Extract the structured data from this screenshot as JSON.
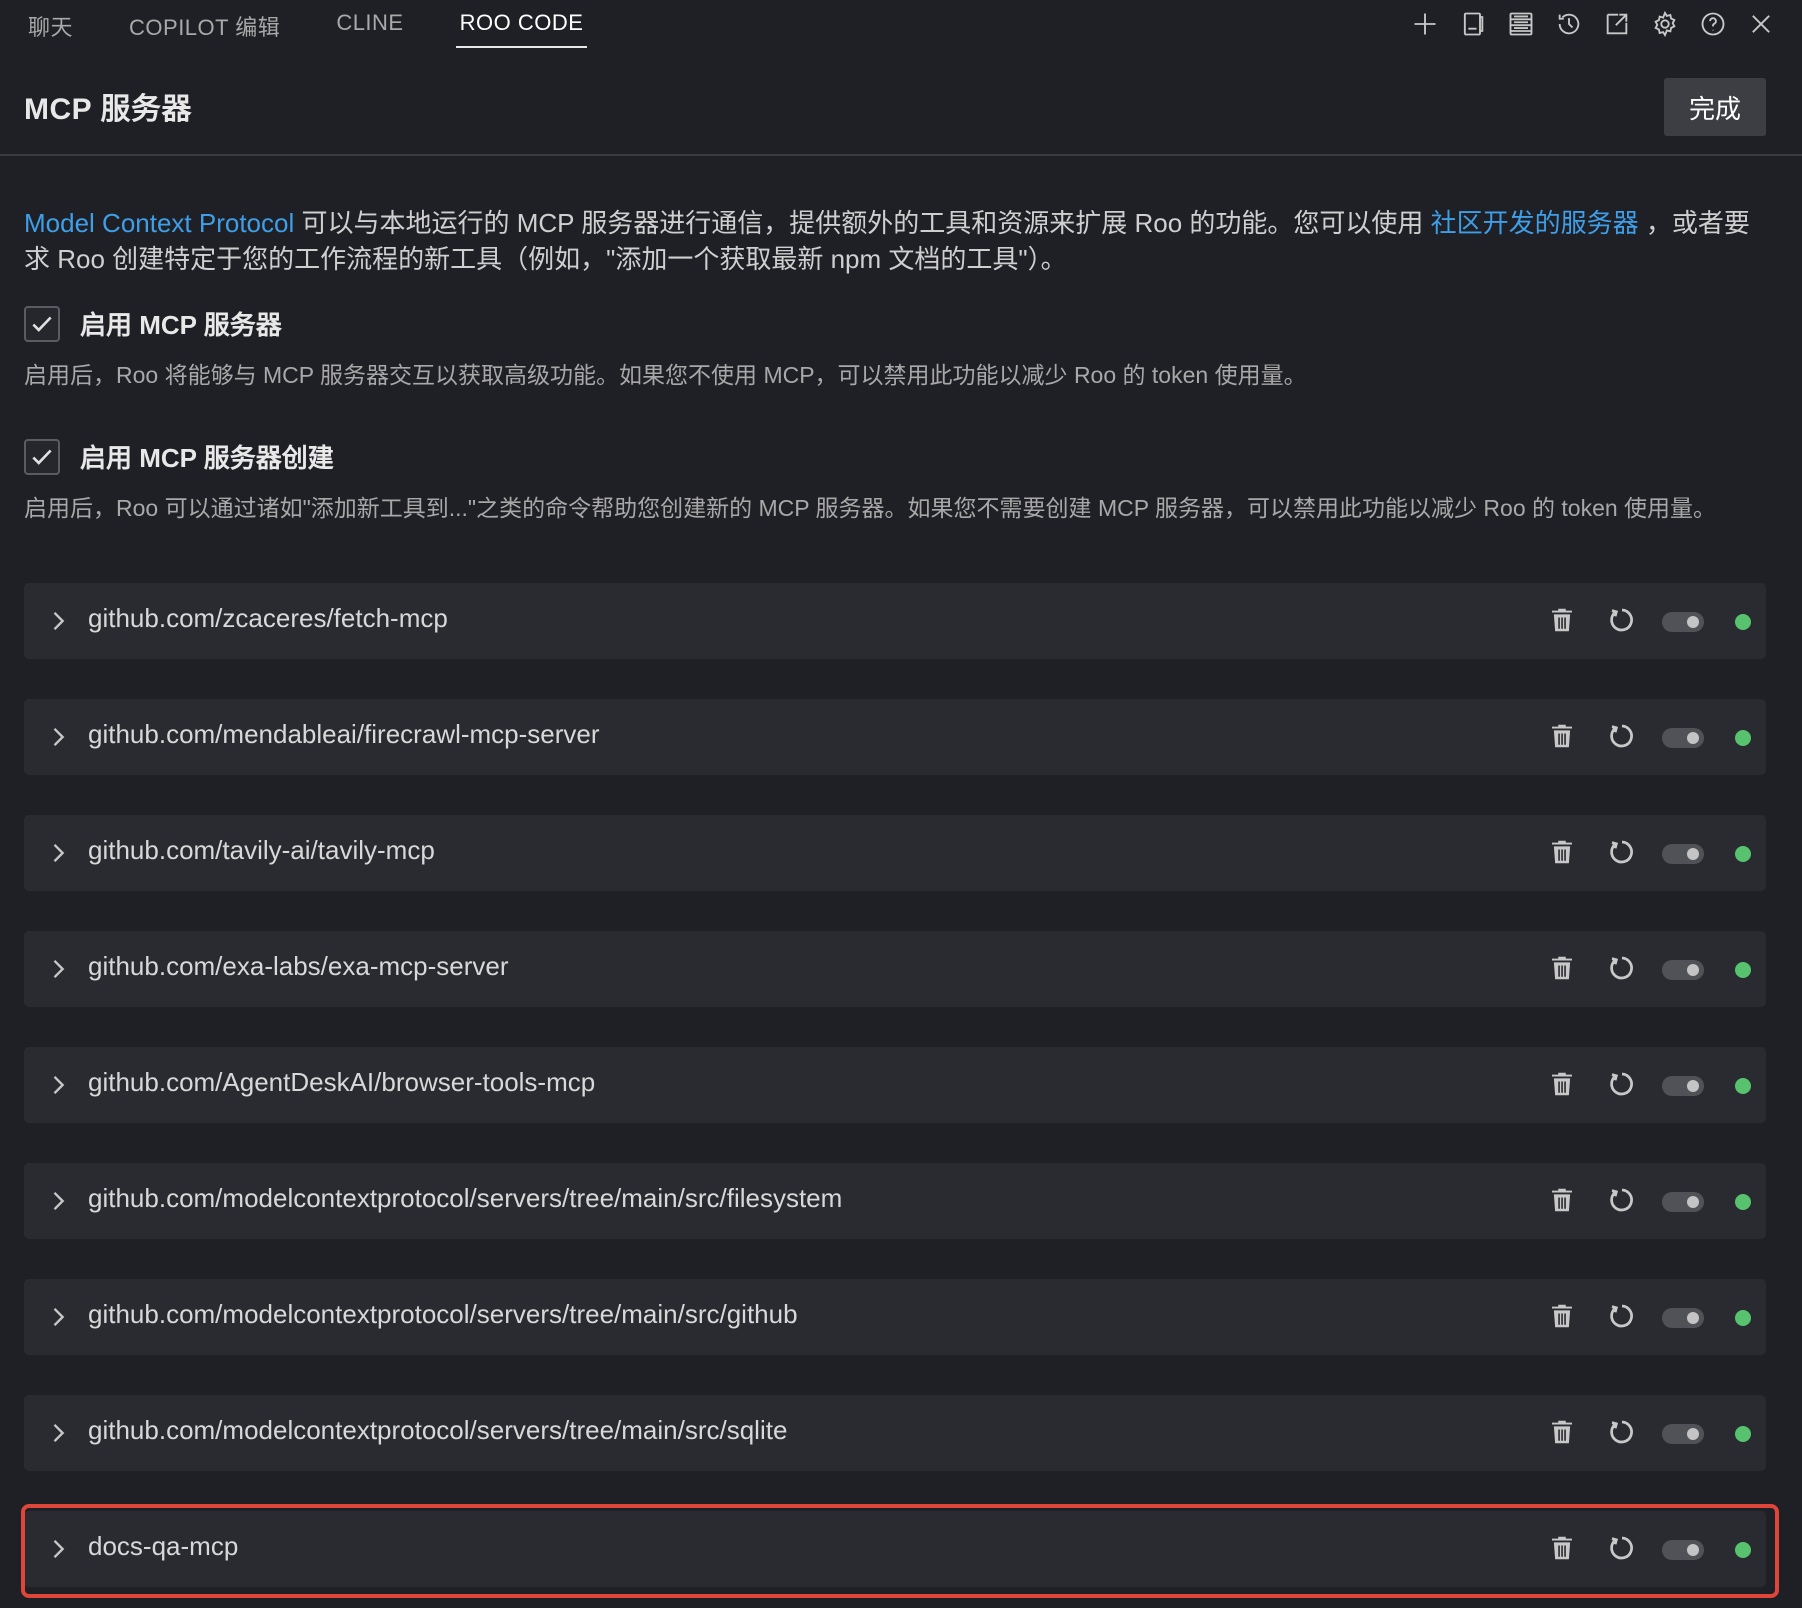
{
  "tabs": [
    {
      "label": "聊天"
    },
    {
      "label": "COPILOT 编辑"
    },
    {
      "label": "CLINE"
    },
    {
      "label": "ROO CODE",
      "active": true
    }
  ],
  "toolbar_icons": [
    "plus-icon",
    "panel-icon",
    "server-stack-icon",
    "history-icon",
    "popout-icon",
    "gear-icon",
    "help-icon",
    "close-icon"
  ],
  "header": {
    "title": "MCP 服务器",
    "done_label": "完成"
  },
  "intro": {
    "link1": "Model Context Protocol",
    "text1": " 可以与本地运行的 MCP 服务器进行通信，提供额外的工具和资源来扩展 Roo 的功能。您可以使用 ",
    "link2": "社区开发的服务器",
    "text2": " ，或者要求 Roo 创建特定于您的工作流程的新工具（例如，\"添加一个获取最新 npm 文档的工具\"）。"
  },
  "options": [
    {
      "label": "启用 MCP 服务器",
      "checked": true,
      "description": "启用后，Roo 将能够与 MCP 服务器交互以获取高级功能。如果您不使用 MCP，可以禁用此功能以减少 Roo 的 token 使用量。"
    },
    {
      "label": "启用 MCP 服务器创建",
      "checked": true,
      "description": "启用后，Roo 可以通过诸如\"添加新工具到...\"之类的命令帮助您创建新的 MCP 服务器。如果您不需要创建 MCP 服务器，可以禁用此功能以减少 Roo 的 token 使用量。"
    }
  ],
  "servers": [
    {
      "name": "github.com/zcaceres/fetch-mcp",
      "enabled": true,
      "status": "connected"
    },
    {
      "name": "github.com/mendableai/firecrawl-mcp-server",
      "enabled": true,
      "status": "connected"
    },
    {
      "name": "github.com/tavily-ai/tavily-mcp",
      "enabled": true,
      "status": "connected"
    },
    {
      "name": "github.com/exa-labs/exa-mcp-server",
      "enabled": true,
      "status": "connected"
    },
    {
      "name": "github.com/AgentDeskAI/browser-tools-mcp",
      "enabled": true,
      "status": "connected"
    },
    {
      "name": "github.com/modelcontextprotocol/servers/tree/main/src/filesystem",
      "enabled": true,
      "status": "connected"
    },
    {
      "name": "github.com/modelcontextprotocol/servers/tree/main/src/github",
      "enabled": true,
      "status": "connected"
    },
    {
      "name": "github.com/modelcontextprotocol/servers/tree/main/src/sqlite",
      "enabled": true,
      "status": "connected"
    },
    {
      "name": "docs-qa-mcp",
      "enabled": true,
      "status": "connected",
      "highlighted": true
    }
  ],
  "colors": {
    "background": "#1f2025",
    "row_background": "#2a2b30",
    "link": "#3f9ee8",
    "status_connected": "#57c36f",
    "highlight_border": "#e0453a"
  }
}
